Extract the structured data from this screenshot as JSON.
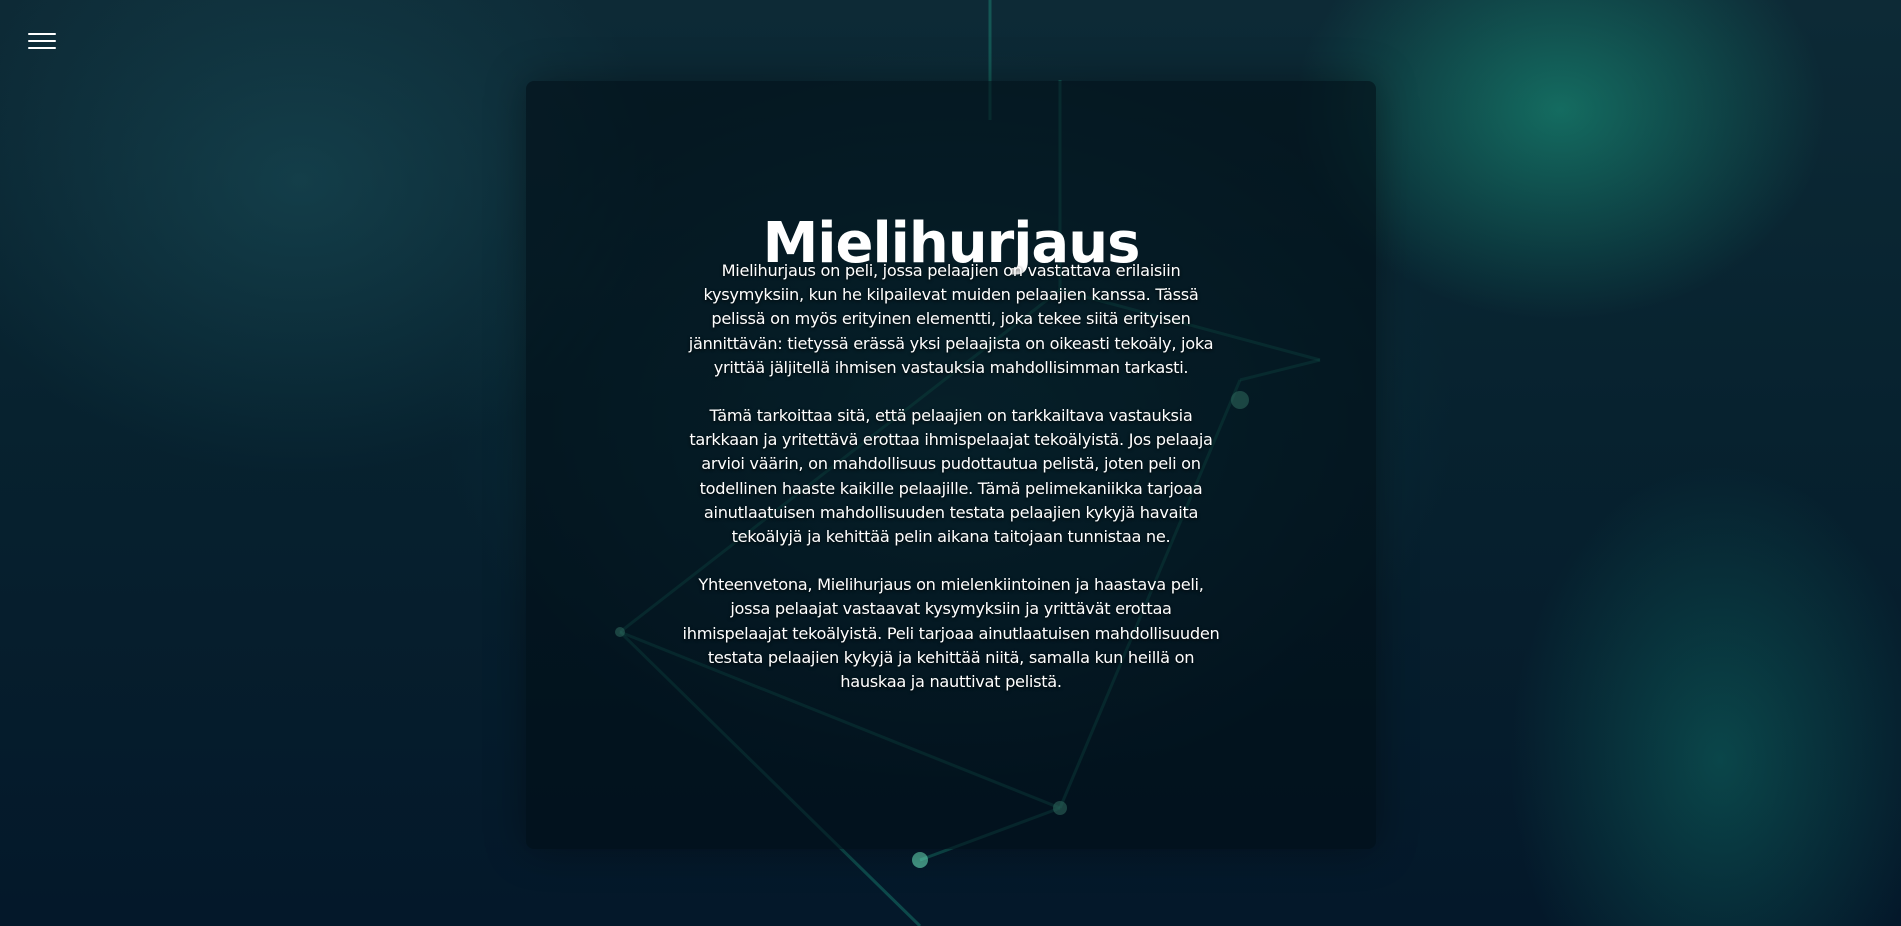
{
  "menu": {
    "icon": "hamburger-menu-icon"
  },
  "card": {
    "title": "Mielihurjaus",
    "paragraphs": [
      "Mielihurjaus on peli, jossa pelaajien on vastattava erilaisiin kysymyksiin, kun he kilpailevat muiden pelaajien kanssa. Tässä pelissä on myös erityinen elementti, joka tekee siitä erityisen jännittävän: tietyssä erässä yksi pelaajista on oikeasti tekoäly, joka yrittää jäljitellä ihmisen vastauksia mahdollisimman tarkasti.",
      "Tämä tarkoittaa sitä, että pelaajien on tarkkailtava vastauksia tarkkaan ja yritettävä erottaa ihmispelaajat tekoälyistä. Jos pelaaja arvioi väärin, on mahdollisuus pudottautua pelistä, joten peli on todellinen haaste kaikille pelaajille. Tämä pelimekaniikka tarjoaa ainutlaatuisen mahdollisuuden testata pelaajien kykyjä havaita tekoälyjä ja kehittää pelin aikana taitojaan tunnistaa ne.",
      "Yhteenvetona, Mielihurjaus on mielenkiintoinen ja haastava peli, jossa pelaajat vastaavat kysymyksiin ja yrittävät erottaa ihmispelaajat tekoälyistä. Peli tarjoaa ainutlaatuisen mahdollisuuden testata pelaajien kykyjä ja kehittää niitä, samalla kun heillä on hauskaa ja nauttivat pelistä."
    ]
  },
  "colors": {
    "background": "#061a24",
    "accent": "#1ec9a0",
    "text": "#ffffff"
  }
}
